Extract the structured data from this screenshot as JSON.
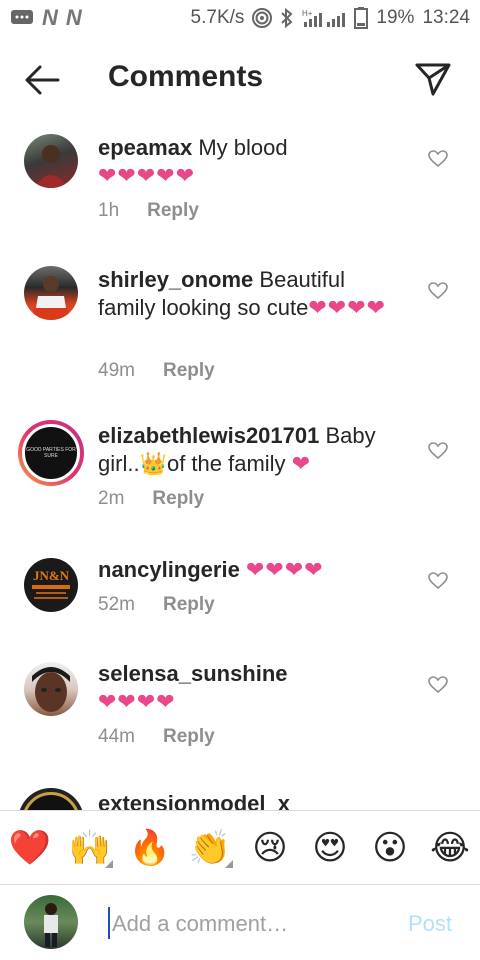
{
  "status_bar": {
    "speed": "5.7K/s",
    "battery": "19%",
    "time": "13:24",
    "network_label": "H+"
  },
  "header": {
    "title": "Comments"
  },
  "comments": [
    {
      "user": "epeamax",
      "text": "My blood",
      "hearts": "❤❤❤❤❤",
      "time": "1h",
      "reply": "Reply"
    },
    {
      "user": "shirley_onome",
      "text": "Beautiful family looking so cute",
      "hearts": "❤❤❤❤",
      "time": "49m",
      "reply": "Reply"
    },
    {
      "user": "elizabethlewis201701",
      "text": "Baby girl..👑of the family",
      "hearts": "❤",
      "time": "2m",
      "reply": "Reply",
      "avatar_text": "GOOD PARTIES FOR SURE"
    },
    {
      "user": "nancylingerie",
      "text": "",
      "hearts": "❤❤❤❤",
      "time": "52m",
      "reply": "Reply"
    },
    {
      "user": "selensa_sunshine",
      "text": "",
      "hearts": "❤❤❤❤",
      "time": "44m",
      "reply": "Reply"
    },
    {
      "user": "extensionmodel_x",
      "text": "",
      "hearts": "",
      "time": "",
      "reply": ""
    }
  ],
  "emoji_bar": [
    "❤️",
    "🙌",
    "🔥",
    "👏",
    "😢",
    "😍",
    "😮",
    "😂"
  ],
  "input": {
    "placeholder": "Add a comment…",
    "value": "",
    "post_label": "Post"
  },
  "colors": {
    "heart": "#e8488a",
    "post_disabled": "#b2dffc",
    "meta_gray": "#8e8e8e"
  },
  "icons": [
    "back-arrow-icon",
    "direct-send-icon",
    "like-heart-icon"
  ]
}
